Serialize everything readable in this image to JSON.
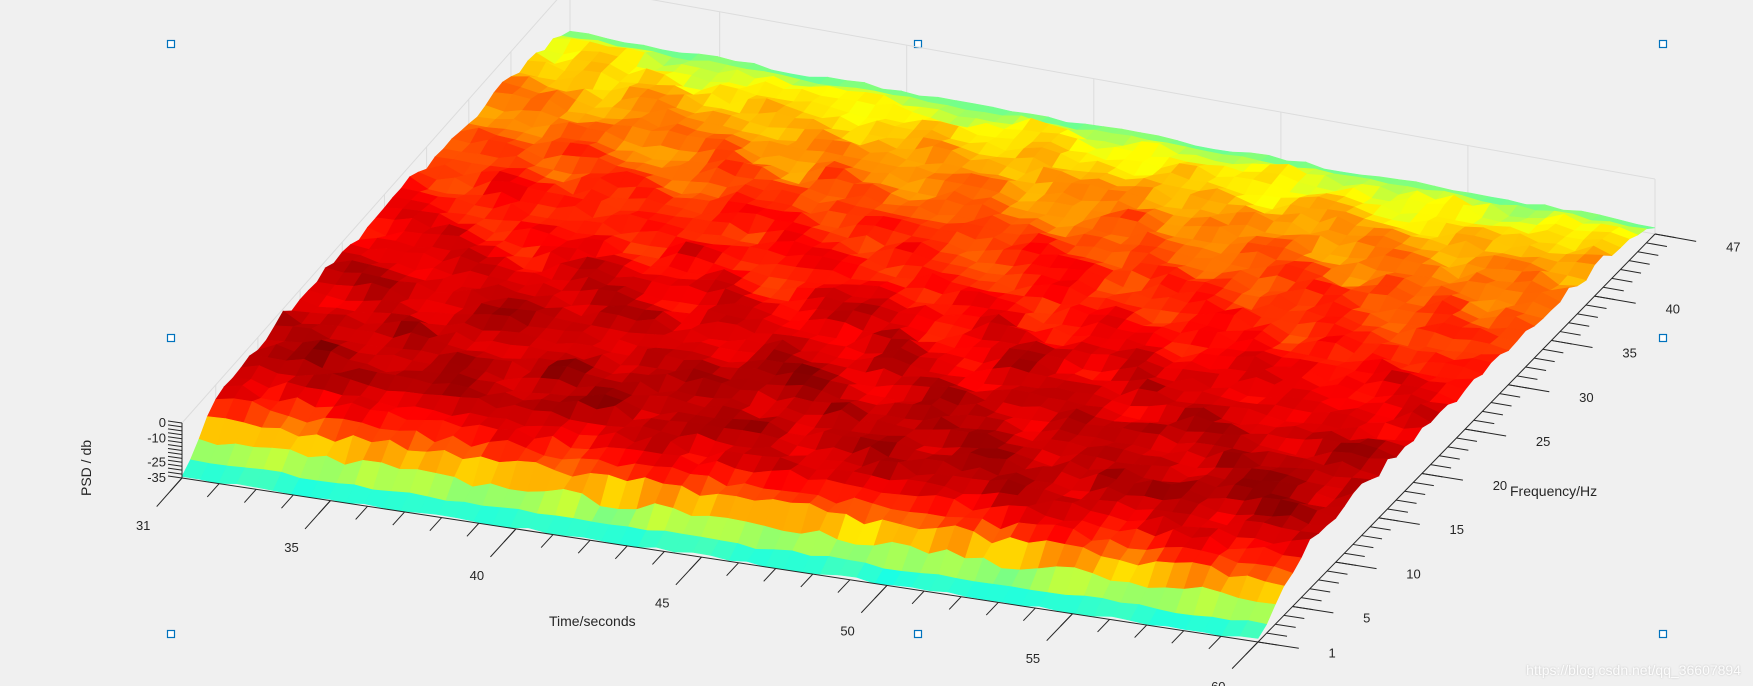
{
  "chart_data": {
    "type": "surface",
    "xlabel": "Time/seconds",
    "ylabel": "Frequency/Hz",
    "zlabel": "PSD / db",
    "xlim": [
      31,
      60
    ],
    "ylim": [
      1,
      47
    ],
    "zlim": [
      -35,
      0
    ],
    "x_ticks": [
      31,
      35,
      40,
      45,
      50,
      55,
      60
    ],
    "y_ticks": [
      1,
      5,
      10,
      15,
      20,
      25,
      30,
      35,
      40,
      47
    ],
    "z_ticks": [
      0,
      -10,
      -25,
      -35
    ],
    "z_tick_labels": [
      "0",
      "-10",
      "-25",
      "-35"
    ],
    "colormap": "jet",
    "grid": true,
    "surface_profile": {
      "frequency_hz": [
        1,
        2,
        4,
        6,
        8,
        10,
        15,
        20,
        25,
        30,
        35,
        40,
        45,
        47
      ],
      "mean_psd_db": [
        -34,
        -30,
        -14,
        -8,
        -6,
        -5,
        -6,
        -7,
        -9,
        -11,
        -14,
        -17,
        -23,
        -30
      ]
    }
  },
  "watermark": "https://blog.csdn.net/qq_36607894",
  "colors": {
    "background": "#f0f0f0",
    "axis": "#262626",
    "grid": "#dcdcdc",
    "selection_handle": "#0072bd"
  }
}
